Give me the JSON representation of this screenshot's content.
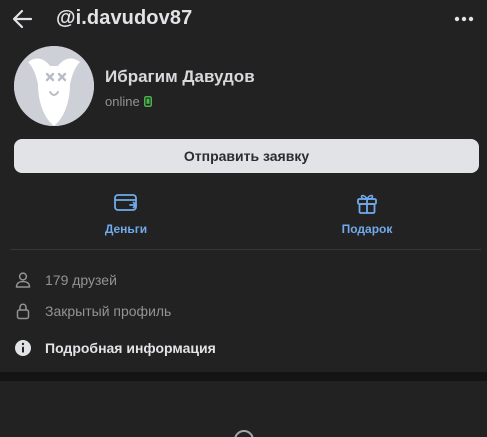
{
  "header": {
    "back_icon": "arrow-left-icon",
    "title": "@i.davudov87",
    "more_icon": "more-horizontal-icon"
  },
  "profile": {
    "avatar": "deactivated-dog-avatar",
    "name": "Ибрагим Давудов",
    "status": "online",
    "status_icon": "mobile-phone-icon",
    "status_color": "#4bb34b"
  },
  "request_button": {
    "label": "Отправить заявку"
  },
  "actions": [
    {
      "label": "Деньги",
      "icon": "money-card-icon"
    },
    {
      "label": "Подарок",
      "icon": "gift-icon"
    }
  ],
  "info": {
    "friends": {
      "text": "179 друзей",
      "icon": "user-icon"
    },
    "private": {
      "text": "Закрытый профиль",
      "icon": "lock-icon"
    },
    "details": {
      "text": "Подробная информация",
      "icon": "info-circle-icon"
    }
  },
  "colors": {
    "accent": "#71aaeb",
    "background": "#141414",
    "card": "#222222",
    "button_bg": "#e1e3e6"
  }
}
